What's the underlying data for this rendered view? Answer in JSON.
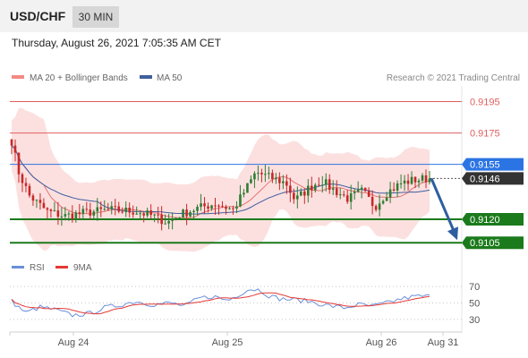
{
  "header": {
    "symbol": "USD/CHF",
    "timeframe": "30 MIN",
    "datetime": "Thursday, August 26, 2021 7:05:35 AM CET"
  },
  "legend": {
    "ma20": "MA 20 + Bollinger Bands",
    "ma50": "MA 50",
    "credit": "Research © 2021 Trading Central"
  },
  "rsi_legend": {
    "rsi": "RSI",
    "ma": "9MA"
  },
  "colors": {
    "candle_up": "#2e7d32",
    "candle_down": "#c62828",
    "ma20": "#e57373",
    "band_fill": "#fbd5d5",
    "ma50": "#3f5f9f",
    "support": "#1b7a1b",
    "resistance": "#e06060",
    "current": "#2b74e3",
    "arrow": "#2f5ea0",
    "rsi": "#6b8fd8",
    "rsi_ma": "#e53935"
  },
  "chart_data": {
    "type": "candlestick",
    "x_ticks": [
      "Aug 24",
      "Aug 25",
      "Aug 26",
      "Aug 31"
    ],
    "price_range": [
      0.91,
      0.9205
    ],
    "levels": [
      {
        "label": "0.9195",
        "value": 0.9195,
        "kind": "resistance"
      },
      {
        "label": "0.9175",
        "value": 0.9175,
        "kind": "resistance"
      },
      {
        "label": "0.9155",
        "value": 0.9155,
        "kind": "current-line"
      },
      {
        "label": "0.9146",
        "value": 0.9146,
        "kind": "last-price"
      },
      {
        "label": "0.9120",
        "value": 0.912,
        "kind": "support"
      },
      {
        "label": "0.9105",
        "value": 0.9105,
        "kind": "support"
      }
    ],
    "arrow": {
      "from": 0.9146,
      "to": 0.9105
    },
    "close_path": [
      [
        0,
        0.917
      ],
      [
        4,
        0.915
      ],
      [
        10,
        0.9135
      ],
      [
        20,
        0.9125
      ],
      [
        30,
        0.9122
      ],
      [
        40,
        0.9124
      ],
      [
        55,
        0.9126
      ],
      [
        70,
        0.9125
      ],
      [
        80,
        0.9122
      ],
      [
        88,
        0.9118
      ],
      [
        95,
        0.9123
      ],
      [
        105,
        0.9127
      ],
      [
        115,
        0.913
      ],
      [
        125,
        0.9126
      ],
      [
        130,
        0.9135
      ],
      [
        138,
        0.915
      ],
      [
        145,
        0.9147
      ],
      [
        155,
        0.9143
      ],
      [
        160,
        0.9132
      ],
      [
        168,
        0.914
      ],
      [
        175,
        0.9145
      ],
      [
        180,
        0.914
      ],
      [
        190,
        0.9133
      ],
      [
        198,
        0.9138
      ],
      [
        205,
        0.9128
      ],
      [
        212,
        0.9137
      ],
      [
        220,
        0.9143
      ],
      [
        227,
        0.9145
      ],
      [
        235,
        0.9146
      ],
      [
        236,
        0.9146
      ]
    ],
    "rsi": {
      "levels": [
        70,
        50,
        30
      ],
      "range": [
        20,
        80
      ],
      "path": [
        [
          0,
          52
        ],
        [
          8,
          38
        ],
        [
          16,
          45
        ],
        [
          24,
          42
        ],
        [
          34,
          35
        ],
        [
          44,
          37
        ],
        [
          52,
          44
        ],
        [
          60,
          47
        ],
        [
          70,
          52
        ],
        [
          80,
          48
        ],
        [
          90,
          50
        ],
        [
          98,
          46
        ],
        [
          106,
          56
        ],
        [
          114,
          58
        ],
        [
          122,
          53
        ],
        [
          128,
          60
        ],
        [
          134,
          67
        ],
        [
          140,
          66
        ],
        [
          146,
          58
        ],
        [
          152,
          55
        ],
        [
          160,
          54
        ],
        [
          168,
          52
        ],
        [
          178,
          47
        ],
        [
          188,
          44
        ],
        [
          196,
          48
        ],
        [
          204,
          46
        ],
        [
          212,
          50
        ],
        [
          220,
          55
        ],
        [
          228,
          58
        ],
        [
          236,
          58
        ]
      ]
    }
  }
}
